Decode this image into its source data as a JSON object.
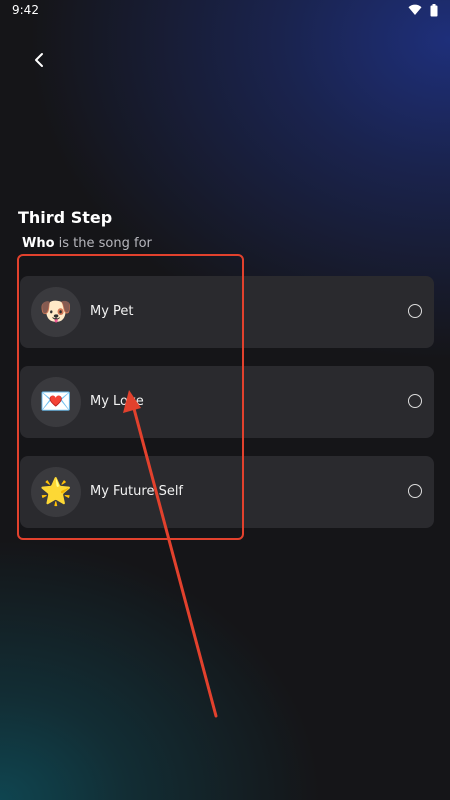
{
  "status_bar": {
    "time": "9:42",
    "wifi_icon": "wifi-icon",
    "battery_icon": "battery-icon"
  },
  "header": {
    "back_icon": "chevron-left-icon"
  },
  "step": {
    "title": "Third Step",
    "subtitle_strong": "Who",
    "subtitle_rest": " is the song for"
  },
  "options": [
    {
      "emoji": "🐶",
      "icon": "dog-face-icon",
      "label": "My Pet",
      "selected": false
    },
    {
      "emoji": "💌",
      "icon": "love-letter-icon",
      "label": "My Love",
      "selected": false
    },
    {
      "emoji": "🌟",
      "icon": "glowing-star-icon",
      "label": "My Future Self",
      "selected": false
    }
  ],
  "annotation": {
    "color": "#e2412d"
  }
}
